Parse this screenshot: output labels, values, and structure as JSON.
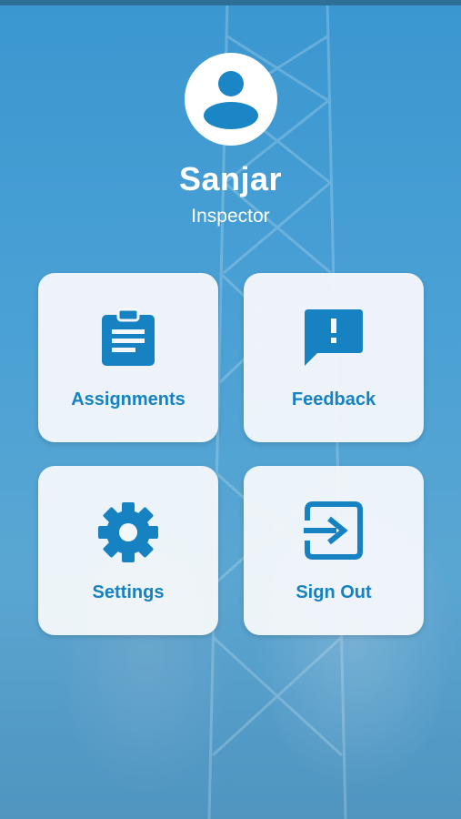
{
  "user": {
    "name": "Sanjar",
    "role": "Inspector"
  },
  "colors": {
    "accent": "#1682c1",
    "background": "#3a94cc",
    "tile": "#f4f7fa"
  },
  "menu": [
    {
      "label": "Assignments",
      "icon": "clipboard-icon"
    },
    {
      "label": "Feedback",
      "icon": "feedback-icon"
    },
    {
      "label": "Settings",
      "icon": "gear-icon"
    },
    {
      "label": "Sign Out",
      "icon": "sign-out-icon"
    }
  ]
}
